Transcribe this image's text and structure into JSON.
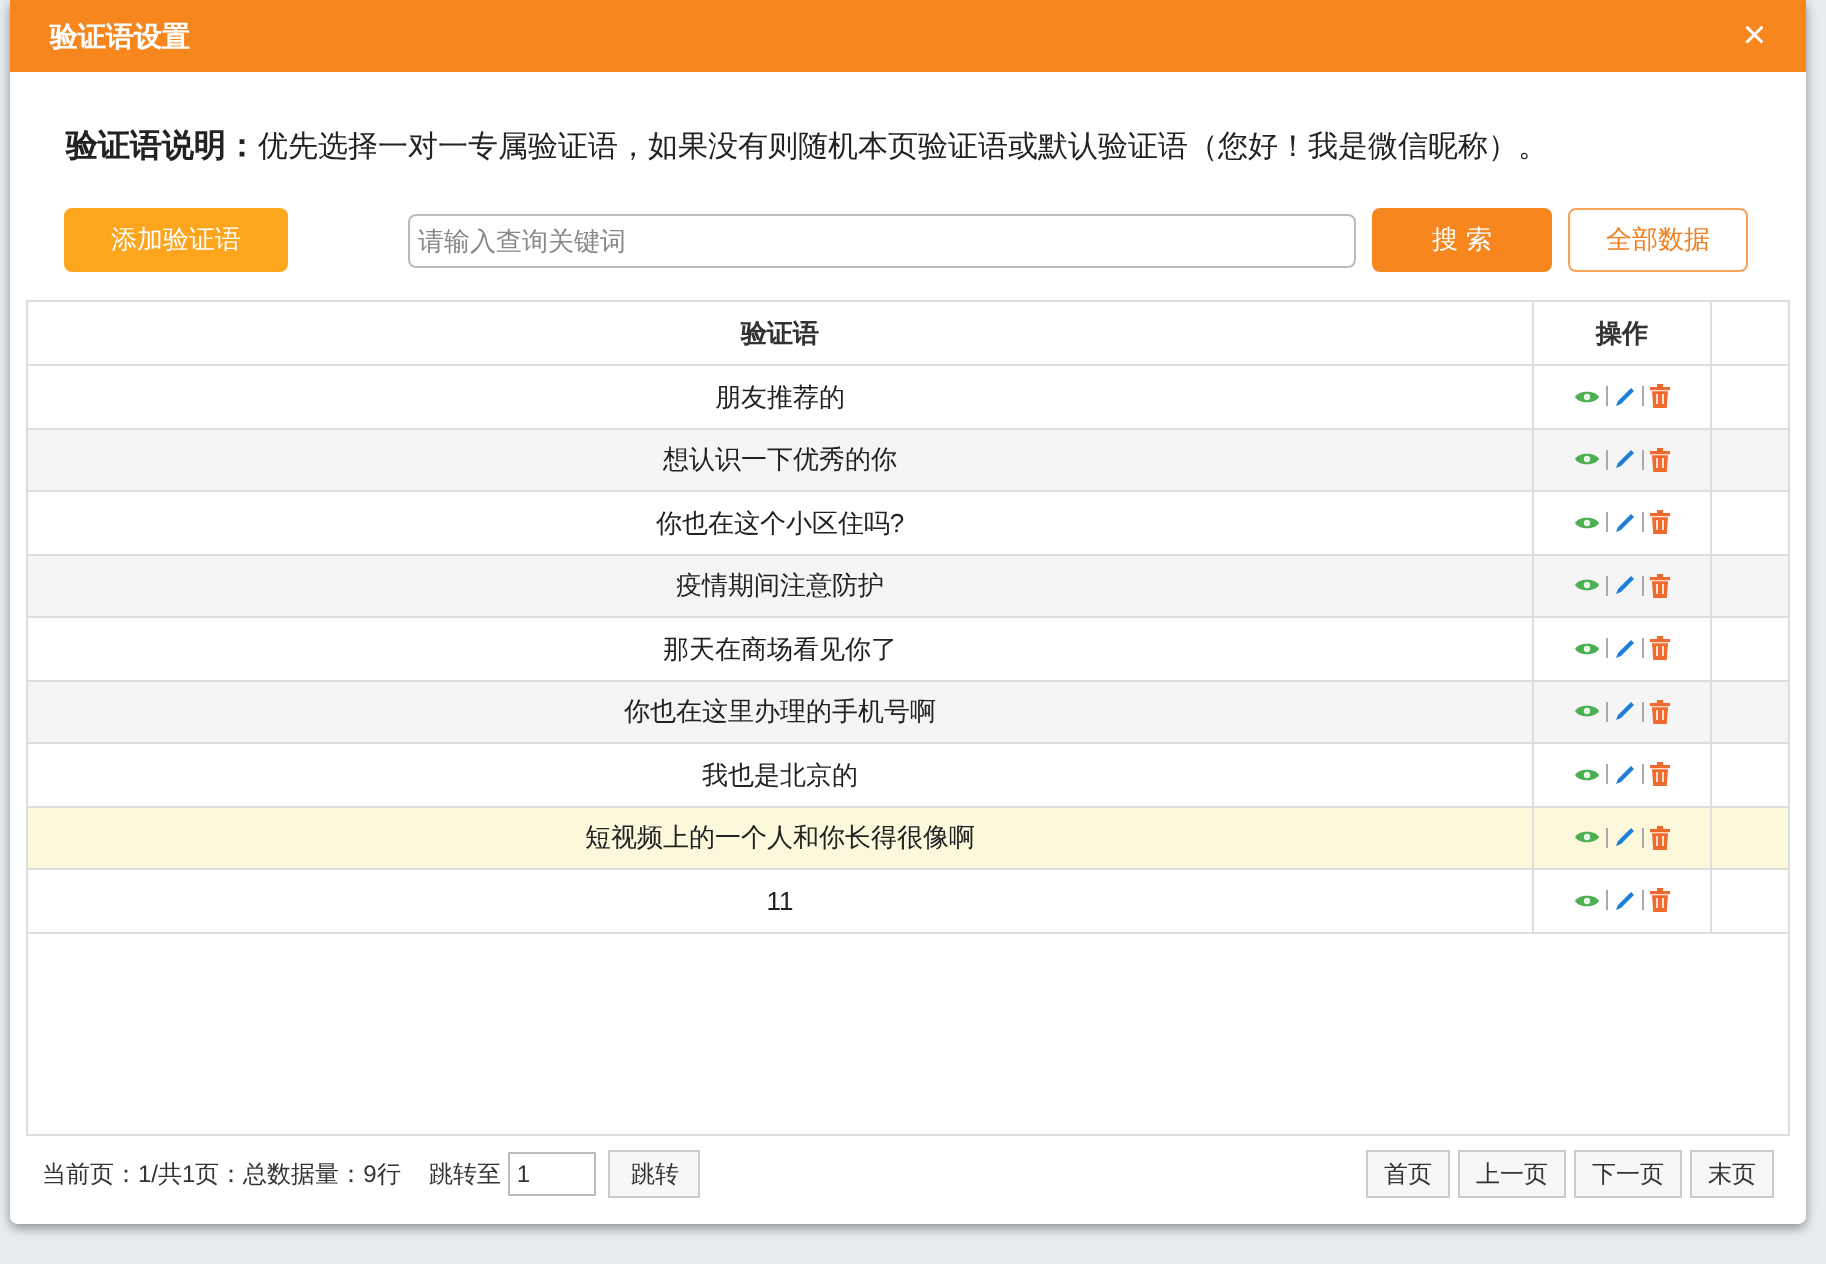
{
  "dialog": {
    "title": "验证语设置",
    "close": "×"
  },
  "description": {
    "label": "验证语说明：",
    "text": "优先选择一对一专属验证语，如果没有则随机本页验证语或默认验证语（您好！我是微信昵称）。"
  },
  "toolbar": {
    "add_button": "添加验证语",
    "search": {
      "placeholder": "请输入查询关键词"
    },
    "search_button": "搜 索",
    "all_button": "全部数据"
  },
  "table": {
    "columns": [
      "验证语",
      "操作"
    ],
    "rows": [
      {
        "text": "朋友推荐的",
        "highlighted": false
      },
      {
        "text": "想认识一下优秀的你",
        "highlighted": false
      },
      {
        "text": "你也在这个小区住吗?",
        "highlighted": false
      },
      {
        "text": "疫情期间注意防护",
        "highlighted": false
      },
      {
        "text": "那天在商场看见你了",
        "highlighted": false
      },
      {
        "text": "你也在这里办理的手机号啊",
        "highlighted": false
      },
      {
        "text": "我也是北京的",
        "highlighted": false
      },
      {
        "text": "短视频上的一个人和你长得很像啊",
        "highlighted": true
      },
      {
        "text": "11",
        "highlighted": false
      }
    ]
  },
  "footer": {
    "info": "当前页：1/共1页：总数据量：9行",
    "jump_label": "跳转至",
    "jump_value": "1",
    "jump_button": "跳转",
    "pages": [
      "首页",
      "上一页",
      "下一页",
      "末页"
    ]
  }
}
